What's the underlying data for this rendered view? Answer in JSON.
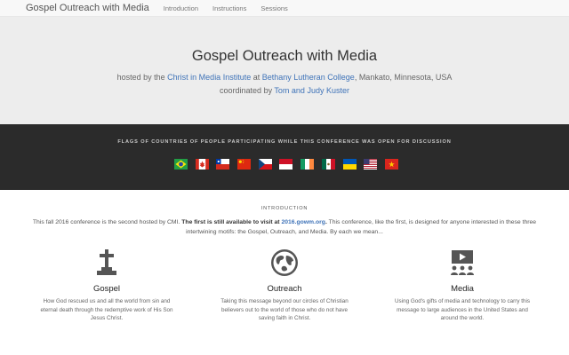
{
  "navbar": {
    "brand": "Gospel Outreach with Media",
    "links": [
      "Introduction",
      "Instructions",
      "Sessions"
    ]
  },
  "hero": {
    "title": "Gospel Outreach with Media",
    "hosted_prefix": "hosted by the ",
    "host_link": "Christ in Media Institute",
    "hosted_mid": " at ",
    "college_link": "Bethany Lutheran College",
    "hosted_suffix": ", Mankato, Minnesota, USA",
    "coord_prefix": "coordinated by ",
    "coord_link": "Tom and Judy Kuster"
  },
  "flags": {
    "heading": "FLAGS OF COUNTRIES OF PEOPLE PARTICIPATING WHILE THIS CONFERENCE WAS OPEN FOR DISCUSSION",
    "items": [
      "brazil-flag",
      "canada-flag",
      "chile-flag",
      "china-flag",
      "czech-flag",
      "indonesia-flag",
      "ireland-flag",
      "mexico-flag",
      "ukraine-flag",
      "usa-flag",
      "vietnam-flag"
    ]
  },
  "introduction": {
    "label": "INTRODUCTION",
    "text_part1": "This fall 2016 conference is the second hosted by CMI. ",
    "text_bold": "The first is still available to visit at ",
    "text_link": "2016.gowm.org",
    "text_bold_end": ".",
    "text_part2": " This conference, like the first, is designed for anyone interested in these three intertwining motifs: the Gospel, Outreach, and Media. By each we mean..."
  },
  "motifs": [
    {
      "icon": "cross-grave-icon",
      "title": "Gospel",
      "text": "How God rescued us and all the world from sin and eternal death through the redemptive work of His Son Jesus Christ."
    },
    {
      "icon": "globe-icon",
      "title": "Outreach",
      "text": "Taking this message beyond our circles of Christian believers out to the world of those who do not have saving faith in Christ."
    },
    {
      "icon": "presentation-icon",
      "title": "Media",
      "text": "Using God's gifts of media and technology to carry this message to large audiences in the United States and around the world."
    }
  ]
}
